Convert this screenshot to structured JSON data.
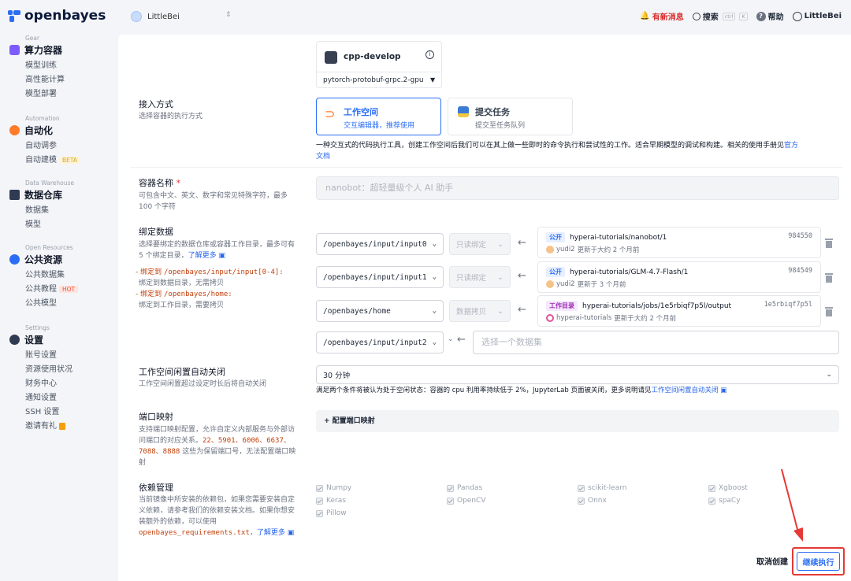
{
  "brand": {
    "name": "openbayes"
  },
  "sidebar": {
    "sections": [
      {
        "label": "Gear",
        "title": "算力容器",
        "icon_color": "#7c5cff",
        "items": [
          {
            "label": "模型训练"
          },
          {
            "label": "高性能计算"
          },
          {
            "label": "模型部署"
          }
        ]
      },
      {
        "label": "Automation",
        "title": "自动化",
        "icon_color": "#ff7a29",
        "items": [
          {
            "label": "自动调参"
          },
          {
            "label": "自动建模",
            "tag": "BETA"
          }
        ]
      },
      {
        "label": "Data Warehouse",
        "title": "数据仓库",
        "icon_color": "#2f3b52",
        "items": [
          {
            "label": "数据集"
          },
          {
            "label": "模型"
          }
        ]
      },
      {
        "label": "Open Resources",
        "title": "公共资源",
        "icon_color": "#2b6ef5",
        "items": [
          {
            "label": "公共数据集"
          },
          {
            "label": "公共教程",
            "tag": "HOT"
          },
          {
            "label": "公共模型"
          }
        ]
      },
      {
        "label": "Settings",
        "title": "设置",
        "icon_color": "#2f3b52",
        "items": [
          {
            "label": "账号设置"
          },
          {
            "label": "资源使用状况"
          },
          {
            "label": "财务中心"
          },
          {
            "label": "通知设置"
          },
          {
            "label": "SSH 设置"
          },
          {
            "label": "邀请有礼"
          }
        ]
      }
    ]
  },
  "topbar": {
    "workspace": "LittleBei",
    "news": "有新消息",
    "search": "搜索",
    "kbd1": "ctrl",
    "kbd2": "K",
    "help": "帮助",
    "user": "LittleBei"
  },
  "image": {
    "name": "cpp-develop",
    "version": "pytorch-protobuf-grpc.2-gpu"
  },
  "access": {
    "label": "接入方式",
    "sub": "选择容器的执行方式",
    "workspace_title": "工作空间",
    "workspace_sub": "交互编辑器，推荐使用",
    "task_title": "提交任务",
    "task_sub": "提交至任务队列",
    "desc": "一种交互式的代码执行工具，创建工作空间后我们可以在其上做一些即时的命令执行和尝试性的工作。适合早期模型的调试和构建。相关的使用手册见",
    "desc_link1": "官方",
    "desc_link2": "文档"
  },
  "container": {
    "label": "容器名称",
    "req": "*",
    "sub1": "可包含中文、英文、数字和常见特殊字符，最多",
    "sub2": "100 个字符",
    "value": "nanobot：超轻量级个人 AI 助手"
  },
  "bind": {
    "label": "绑定数据",
    "sub1": "选择要绑定的数据仓库或容器工作目录，最多可有",
    "sub2": "5 个绑定目录，",
    "learn": "了解更多",
    "rule1_prefix": "- 绑定到 ",
    "rule1_path": "/openbayes/input/input[0-4]:",
    "rule1_desc": "绑定到数据目录，无需拷贝",
    "rule2_prefix": "- 绑定到 ",
    "rule2_path": "/openbayes/home:",
    "rule2_desc": "绑定到工作目录，需要拷贝",
    "rows": [
      {
        "path": "/openbayes/input/input0",
        "mode": "只读绑定",
        "tag": "公开",
        "name": "hyperai-tutorials/nanobot/1",
        "id": "984550",
        "user": "yudi2",
        "updated": "更新于大约 2 个月前"
      },
      {
        "path": "/openbayes/input/input1",
        "mode": "只读绑定",
        "tag": "公开",
        "name": "hyperai-tutorials/GLM-4.7-Flash/1",
        "id": "984549",
        "user": "yudi2",
        "updated": "更新于 3 个月前"
      },
      {
        "path": "/openbayes/home",
        "mode": "数据拷贝",
        "tag": "工作目录",
        "name": "hyperai-tutorials/jobs/1e5rbiqf7p5l/output",
        "id": "1e5rbiqf7p5l",
        "user": "hyperai-tutorials",
        "updated": "更新于大约 2 个月前"
      }
    ],
    "empty_path": "/openbayes/input/input2",
    "empty_placeholder": "选择一个数据集"
  },
  "idle": {
    "label": "工作空间闲置自动关闭",
    "sub": "工作空间闲置超过设定时长后将自动关闭",
    "value": "30 分钟",
    "note": "满足两个条件将被认为处于空闲状态：容器的 cpu 利用率持续低于 2%，JupyterLab 页面被关闭，更多说明请见",
    "note_link": "工作空间闲置自动关闭"
  },
  "ports": {
    "label": "端口映射",
    "sub1": "支持端口映射配置，允许自定义内部服务与外部访",
    "sub2": "问端口的对应关系。",
    "sub_ports": "22、5901、6006、6637、",
    "sub_ports2": "7088、8888",
    "sub3": " 这些为保留端口号，无法配置端口映",
    "sub4": "射",
    "button": "+ 配置端口映射"
  },
  "deps": {
    "label": "依赖管理",
    "sub1": "当前镜像中所安装的依赖包，如果您需要安装自定",
    "sub2": "义依赖，请参考我们的依赖安装文档。如果你想安",
    "sub3": "装额外的依赖，可以使用",
    "file": "openbayes_requirements.txt",
    "sep": "，",
    "learn": "了解更多",
    "packages": [
      "Numpy",
      "Pandas",
      "scikit-learn",
      "Xgboost",
      "Keras",
      "OpenCV",
      "Onnx",
      "spaCy",
      "Pillow"
    ]
  },
  "footer": {
    "cancel": "取消创建",
    "continue": "继续执行"
  },
  "colors": {
    "accent": "#2b6ef5",
    "danger": "#e53935"
  }
}
